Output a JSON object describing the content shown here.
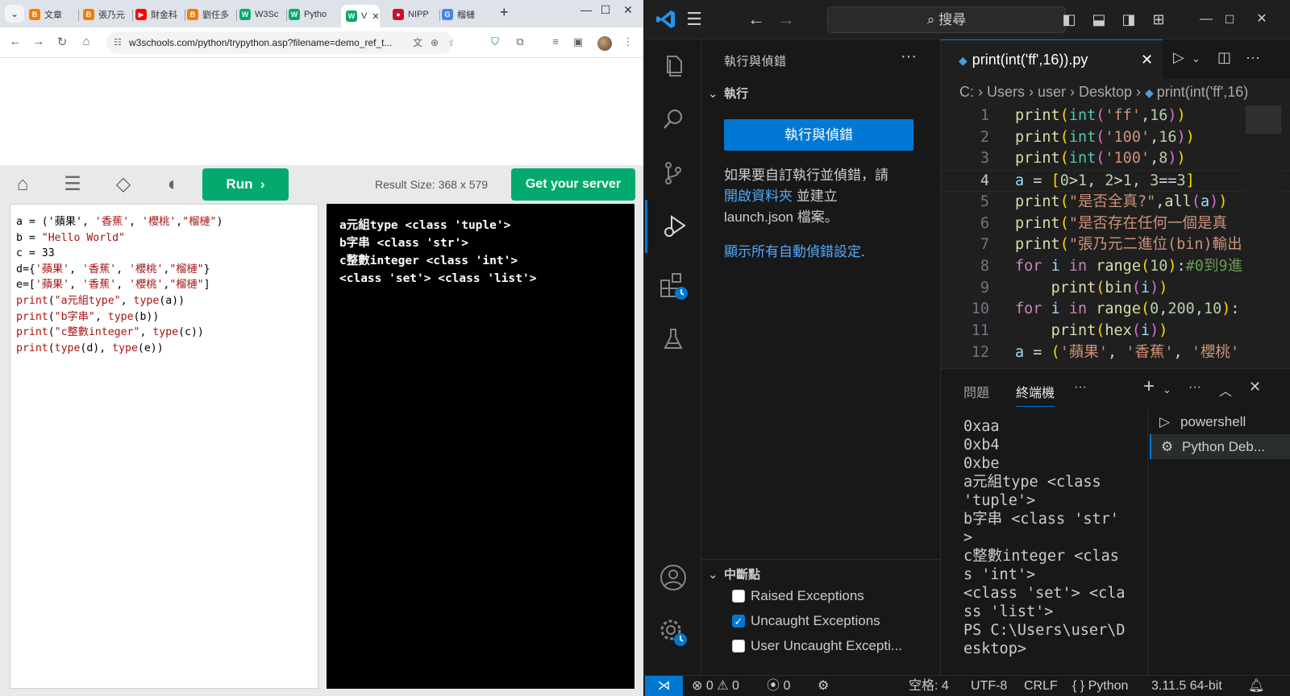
{
  "browser": {
    "tabs": [
      {
        "label": "文章",
        "color": "#f57c00",
        "letter": "B"
      },
      {
        "label": "張乃元",
        "color": "#f57c00",
        "letter": "B"
      },
      {
        "label": "財金科",
        "color": "#ff0000",
        "letter": "▶"
      },
      {
        "label": "劉任多",
        "color": "#f57c00",
        "letter": "B"
      },
      {
        "label": "W3Sc",
        "color": "#04aa6d",
        "letter": "W"
      },
      {
        "label": "Pytho",
        "color": "#04aa6d",
        "letter": "W"
      },
      {
        "label": "V",
        "color": "#04aa6d",
        "letter": "W"
      },
      {
        "label": "NIPP",
        "color": "#c8102e",
        "letter": "●"
      },
      {
        "label": "榴槤",
        "color": "#4285f4",
        "letter": "G"
      }
    ],
    "url": "w3schools.com/python/trypython.asp?filename=demo_ref_t...",
    "toolbar": {
      "run_label": "Run",
      "result_size": "Result Size: 368 x 579",
      "get_server_label": "Get your server"
    },
    "code_lines": [
      [
        {
          "t": "a = ('蘋果', ",
          "c": ""
        },
        {
          "t": "'香蕉'",
          "c": "str"
        },
        {
          "t": ", ",
          "c": ""
        },
        {
          "t": "'櫻桃'",
          "c": "str"
        },
        {
          "t": ",",
          "c": ""
        },
        {
          "t": "\"榴槤\"",
          "c": "str"
        },
        {
          "t": ")",
          "c": ""
        }
      ],
      [
        {
          "t": "b = ",
          "c": ""
        },
        {
          "t": "\"Hello World\"",
          "c": "str"
        }
      ],
      [
        {
          "t": "c = 33",
          "c": ""
        }
      ],
      [
        {
          "t": "d={",
          "c": ""
        },
        {
          "t": "'蘋果'",
          "c": "str"
        },
        {
          "t": ", ",
          "c": ""
        },
        {
          "t": "'香蕉'",
          "c": "str"
        },
        {
          "t": ", ",
          "c": ""
        },
        {
          "t": "'櫻桃'",
          "c": "str"
        },
        {
          "t": ",",
          "c": ""
        },
        {
          "t": "\"榴槤\"",
          "c": "str"
        },
        {
          "t": "}",
          "c": ""
        }
      ],
      [
        {
          "t": "e=[",
          "c": ""
        },
        {
          "t": "'蘋果'",
          "c": "str"
        },
        {
          "t": ", ",
          "c": ""
        },
        {
          "t": "'香蕉'",
          "c": "str"
        },
        {
          "t": ", ",
          "c": ""
        },
        {
          "t": "'櫻桃'",
          "c": "str"
        },
        {
          "t": ",",
          "c": ""
        },
        {
          "t": "\"榴槤\"",
          "c": "str"
        },
        {
          "t": "]",
          "c": ""
        }
      ],
      [
        {
          "t": "print",
          "c": "kw"
        },
        {
          "t": "(",
          "c": ""
        },
        {
          "t": "\"a元組type\"",
          "c": "str"
        },
        {
          "t": ", ",
          "c": ""
        },
        {
          "t": "type",
          "c": "kw"
        },
        {
          "t": "(a))",
          "c": ""
        }
      ],
      [
        {
          "t": "print",
          "c": "kw"
        },
        {
          "t": "(",
          "c": ""
        },
        {
          "t": "\"b字串\"",
          "c": "str"
        },
        {
          "t": ", ",
          "c": ""
        },
        {
          "t": "type",
          "c": "kw"
        },
        {
          "t": "(b))",
          "c": ""
        }
      ],
      [
        {
          "t": "print",
          "c": "kw"
        },
        {
          "t": "(",
          "c": ""
        },
        {
          "t": "\"c整數integer\"",
          "c": "str"
        },
        {
          "t": ", ",
          "c": ""
        },
        {
          "t": "type",
          "c": "kw"
        },
        {
          "t": "(c))",
          "c": ""
        }
      ],
      [
        {
          "t": "print",
          "c": "kw"
        },
        {
          "t": "(",
          "c": ""
        },
        {
          "t": "type",
          "c": "kw"
        },
        {
          "t": "(d), ",
          "c": ""
        },
        {
          "t": "type",
          "c": "kw"
        },
        {
          "t": "(e))",
          "c": ""
        }
      ]
    ],
    "result_lines": [
      "a元組type <class 'tuple'>",
      "b字串 <class 'str'>",
      "c整數integer <class 'int'>",
      "<class 'set'> <class 'list'>"
    ]
  },
  "vscode": {
    "search_placeholder": "搜尋",
    "sidebar": {
      "title": "執行與偵錯",
      "run_section": "執行",
      "run_button": "執行與偵錯",
      "help_text_1": "如果要自訂執行並偵錯，請",
      "open_folder_link": "開啟資料夾",
      "help_text_2": " 並建立",
      "help_text_3": "launch.json 檔案。",
      "show_all_link": "顯示所有自動偵錯設定",
      "breakpoints_section": "中斷點",
      "breakpoints": [
        {
          "label": "Raised Exceptions",
          "checked": false
        },
        {
          "label": "Uncaught Exceptions",
          "checked": true
        },
        {
          "label": "User Uncaught Excepti...",
          "checked": false
        }
      ]
    },
    "editor": {
      "tab_title": "print(int('ff',16)).py",
      "breadcrumb": "C: › Users › user › Desktop › ",
      "breadcrumb_file": "print(int('ff',16)",
      "current_line": 4
    },
    "panel": {
      "tab_problems": "問題",
      "tab_terminal": "終端機",
      "terminal_lines": [
        "0xaa",
        "0xb4",
        "0xbe",
        "a元組type <class",
        "'tuple'>",
        "b字串 <class 'str'",
        ">",
        "c整數integer <clas",
        "s 'int'>",
        "<class 'set'> <cla",
        "ss 'list'>",
        "PS C:\\Users\\user\\D",
        "esktop>"
      ],
      "terminals": [
        {
          "label": "powershell",
          "active": false
        },
        {
          "label": "Python Deb...",
          "active": true
        }
      ]
    },
    "statusbar": {
      "errors": "0",
      "warnings": "0",
      "ports": "0",
      "spaces": "空格: 4",
      "encoding": "UTF-8",
      "eol": "CRLF",
      "language": "Python",
      "interpreter": "3.11.5 64-bit"
    }
  }
}
